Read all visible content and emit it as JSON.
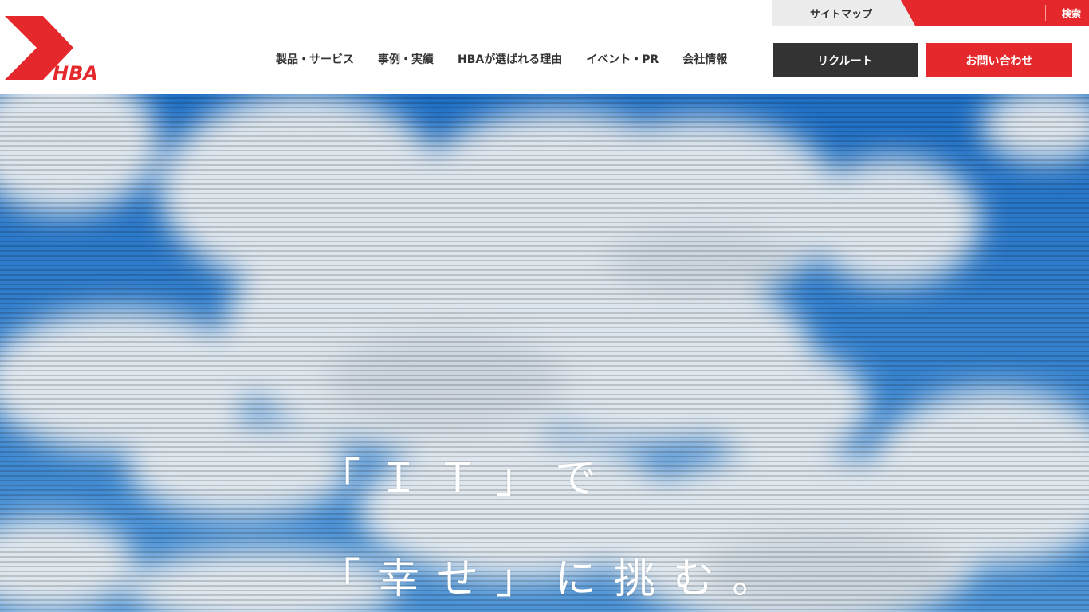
{
  "header": {
    "logo_text": "HBA",
    "utility": {
      "sitemap": "サイトマップ",
      "search": "検索"
    },
    "nav": [
      {
        "label": "製品・サービス"
      },
      {
        "label": "事例・実績"
      },
      {
        "label": "HBAが選ばれる理由"
      },
      {
        "label": "イベント・PR"
      },
      {
        "label": "会社情報"
      }
    ],
    "recruit_button": "リクルート",
    "contact_button": "お問い合わせ"
  },
  "hero": {
    "line1": "「ＩＴ」で",
    "line2": "「幸せ」に挑む。"
  },
  "colors": {
    "brand_red": "#e4282b",
    "dark": "#333333",
    "sky": "#2a78cc"
  }
}
